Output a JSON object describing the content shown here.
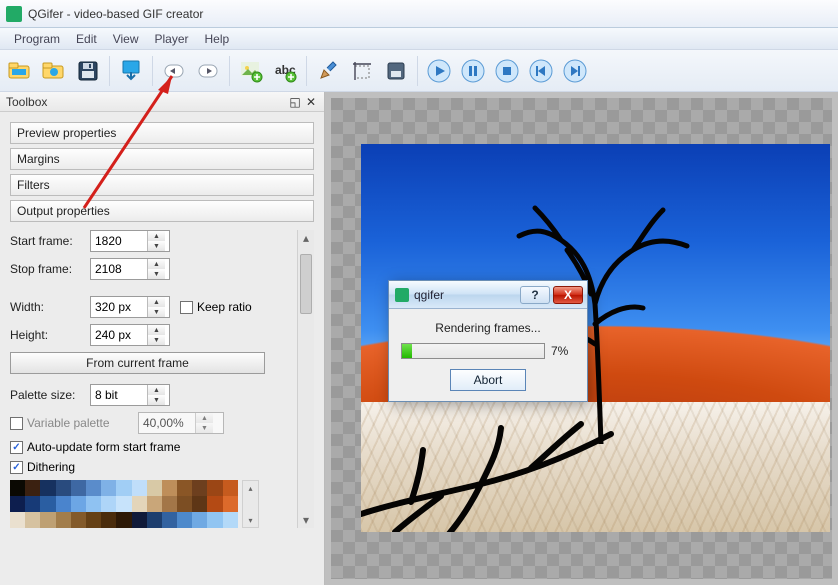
{
  "window": {
    "title": "QGifer - video-based GIF creator"
  },
  "menu": {
    "program": "Program",
    "edit": "Edit",
    "view": "View",
    "player": "Player",
    "help": "Help"
  },
  "toolbox": {
    "title": "Toolbox",
    "sections": {
      "preview": "Preview properties",
      "margins": "Margins",
      "filters": "Filters",
      "output": "Output properties"
    }
  },
  "output": {
    "start_frame_label": "Start frame:",
    "start_frame_value": "1820",
    "stop_frame_label": "Stop frame:",
    "stop_frame_value": "2108",
    "width_label": "Width:",
    "width_value": "320 px",
    "height_label": "Height:",
    "height_value": "240 px",
    "keep_ratio_label": "Keep ratio",
    "from_current_btn": "From current frame",
    "palette_size_label": "Palette size:",
    "palette_size_value": "8 bit",
    "variable_palette_label": "Variable palette",
    "variable_palette_pct": "40,00%",
    "auto_update_label": "Auto-update form start frame",
    "dithering_label": "Dithering"
  },
  "dialog": {
    "title": "qgifer",
    "rendering_label": "Rendering frames...",
    "percent_label": "7%",
    "percent_value": 7,
    "abort_label": "Abort"
  },
  "palette_colors": [
    [
      "#0b0903",
      "#3b2111",
      "#16315f",
      "#294b7e",
      "#3e68a3",
      "#5a8ccb",
      "#7fb1e6",
      "#a1cef5",
      "#c0defa",
      "#d8c9a6",
      "#be8e5a",
      "#8a5626",
      "#6d3f1e",
      "#9b4615",
      "#c65b1e"
    ],
    [
      "#0d1e4e",
      "#173a77",
      "#2a5ea2",
      "#4a84cd",
      "#6ca6e5",
      "#8fc2f2",
      "#aed5f8",
      "#c7e3fb",
      "#e3d5ba",
      "#c9a679",
      "#a37648",
      "#7c4e23",
      "#5e3616",
      "#b44a14",
      "#dc6a2b"
    ],
    [
      "#eae0cf",
      "#d6c2a0",
      "#bea073",
      "#a27d4b",
      "#835a2a",
      "#654015",
      "#4a2c0c",
      "#2d1906",
      "#101a39",
      "#1d3e6e",
      "#3262a0",
      "#4d89cb",
      "#6fa9e3",
      "#91c5f2",
      "#b3d9f8"
    ]
  ]
}
